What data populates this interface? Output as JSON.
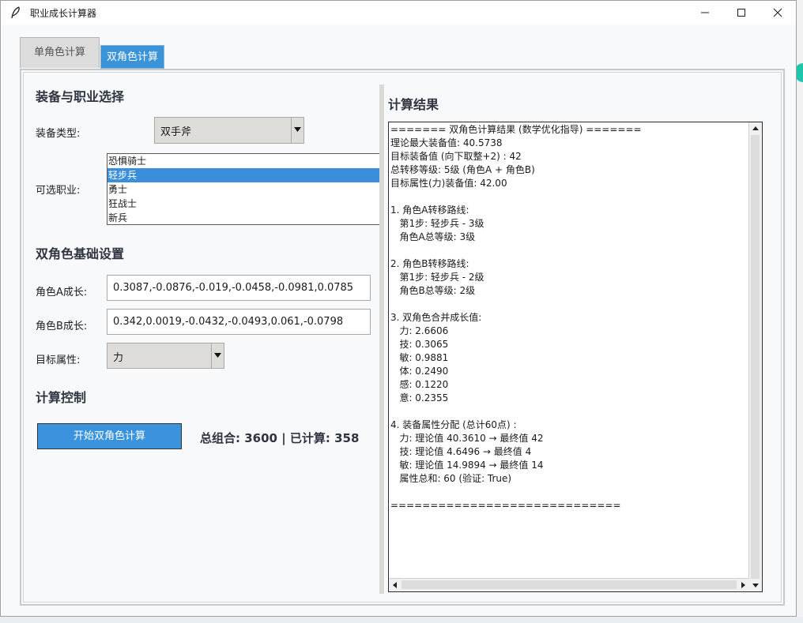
{
  "window": {
    "title": "职业成长计算器"
  },
  "tabs": [
    {
      "label": "单角色计算",
      "active": false
    },
    {
      "label": "双角色计算",
      "active": true
    }
  ],
  "left": {
    "section_equip": "装备与职业选择",
    "equip_type_label": "装备类型:",
    "equip_type_value": "双手斧",
    "career_label": "可选职业:",
    "careers": [
      "恐惧骑士",
      "轻步兵",
      "勇士",
      "狂战士",
      "新兵"
    ],
    "selected_career_index": 1,
    "section_base": "双角色基础设置",
    "growth_a_label": "角色A成长:",
    "growth_a_value": "0.3087,-0.0876,-0.019,-0.0458,-0.0981,0.0785",
    "growth_b_label": "角色B成长:",
    "growth_b_value": "0.342,0.0019,-0.0432,-0.0493,0.061,-0.0798",
    "target_attr_label": "目标属性:",
    "target_attr_value": "力",
    "section_control": "计算控制",
    "start_button": "开始双角色计算",
    "stats": "总组合: 3600 | 已计算: 358"
  },
  "right": {
    "title": "计算结果",
    "lines": [
      "======= 双角色计算结果 (数学优化指导) =======",
      "理论最大装备值: 40.5738",
      "目标装备值 (向下取整+2) : 42",
      "总转移等级: 5级 (角色A + 角色B)",
      "目标属性(力)装备值: 42.00",
      "",
      "1. 角色A转移路线:",
      "   第1步: 轻步兵 - 3级",
      "   角色A总等级: 3级",
      "",
      "2. 角色B转移路线:",
      "   第1步: 轻步兵 - 2级",
      "   角色B总等级: 2级",
      "",
      "3. 双角色合并成长值:",
      "   力: 2.6606",
      "   技: 0.3065",
      "   敏: 0.9881",
      "   体: 0.2490",
      "   感: 0.1220",
      "   意: 0.2355",
      "",
      "4. 装备属性分配 (总计60点) :",
      "   力: 理论值 40.3610 → 最终值 42",
      "   技: 理论值 4.6496 → 最终值 4",
      "   敏: 理论值 14.9894 → 最终值 14",
      "   属性总和: 60 (验证: True)",
      "",
      "============================="
    ]
  },
  "colors": {
    "accent": "#3a93dc",
    "selected": "#3a8edc"
  }
}
